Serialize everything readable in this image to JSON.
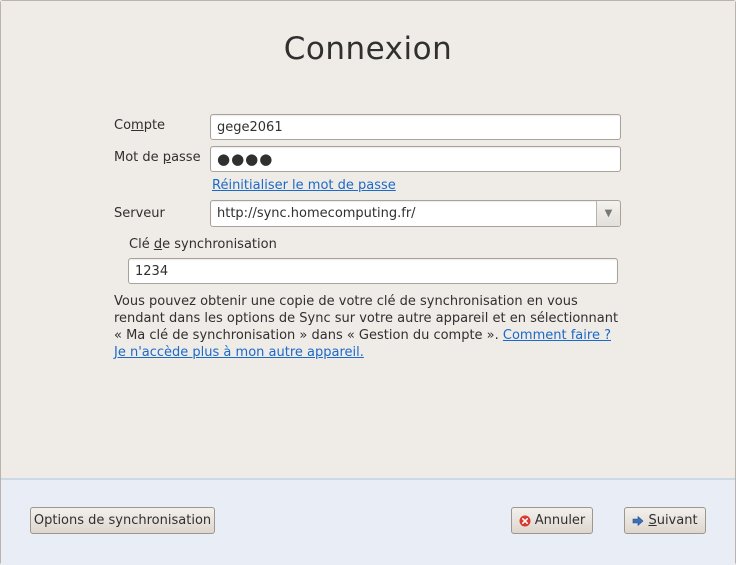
{
  "title": "Connexion",
  "form": {
    "account_label_pre": "Co",
    "account_label_mn": "m",
    "account_label_post": "pte",
    "account_value": "gege2061",
    "password_label_pre": "Mot de ",
    "password_label_mn": "p",
    "password_label_post": "asse",
    "password_value": "●●●●",
    "reset_password_pre": "R",
    "reset_password_rest": "éinitialiser le mot de passe",
    "server_label": "Serveur",
    "server_value": "http://sync.homecomputing.fr/",
    "sync_key_label_pre": "Clé ",
    "sync_key_label_mn": "d",
    "sync_key_label_post": "e synchronisation",
    "sync_key_value": "1234"
  },
  "help": {
    "text": "Vous pouvez obtenir une copie de votre clé de synchronisation en vous rendant dans les options de Sync sur votre autre appareil et en sélectionnant « Ma clé de synchronisation » dans « Gestion du compte ». ",
    "how_link": "Comment faire ?",
    "no_access_link": "Je n'accède plus à mon autre appareil."
  },
  "buttons": {
    "options": "Options de synchronisation",
    "cancel": "Annuler",
    "next_mn": "S",
    "next_rest": "uivant"
  },
  "colors": {
    "link": "#1b6ac9",
    "bottom_pane": "#e9eef6"
  },
  "icons": {
    "cancel": "red-circle-x-icon",
    "next": "blue-arrow-right-icon",
    "combo": "dropdown-arrow-icon"
  }
}
